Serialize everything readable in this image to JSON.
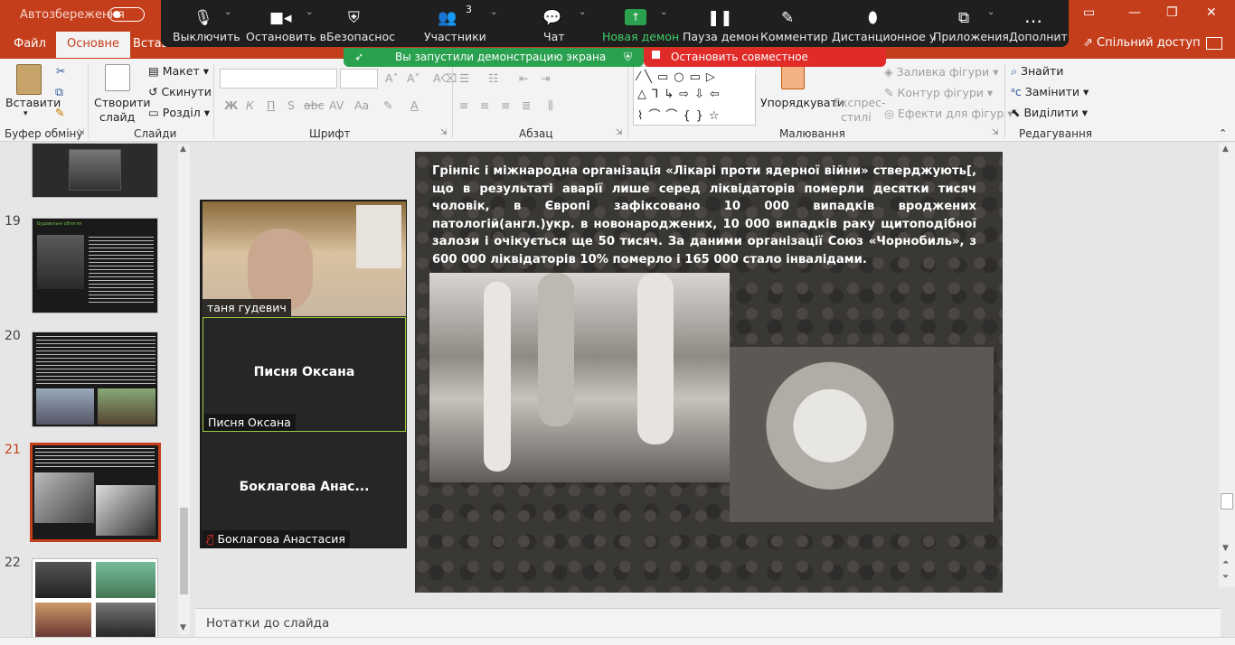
{
  "title_bar": {
    "autosave_label": "Автозбереження",
    "autosave_state": "off"
  },
  "ribbon_tabs": {
    "file": "Файл",
    "home": "Основне",
    "insert": "Вставлення"
  },
  "share_button": "Спільний доступ",
  "zoom_toolbar": {
    "mute": "Выключить",
    "stop_video": "Остановить в",
    "security": "Безопаснос",
    "participants": "Участники",
    "participants_count": "3",
    "chat": "Чат",
    "new_share": "Новая демон",
    "pause_share": "Пауза демон",
    "annotate": "Комментир",
    "remote_control": "Дистанционное у",
    "apps": "Приложения",
    "more": "Дополнит"
  },
  "share_notice": "Вы запустили демонстрацию экрана",
  "stop_share": "Остановить совместное использование",
  "ribbon": {
    "clipboard": {
      "paste": "Вставити",
      "label": "Буфер обміну"
    },
    "slides": {
      "new_slide_1": "Створити",
      "new_slide_2": "слайд",
      "layout": "Макет",
      "reset": "Скинути",
      "section": "Розділ",
      "label": "Слайди"
    },
    "font": {
      "bold": "Ж",
      "italic": "К",
      "underline": "П",
      "strike": "abc",
      "spacing": "AV",
      "case": "Aa",
      "label": "Шрифт"
    },
    "paragraph": {
      "label": "Абзац"
    },
    "drawing": {
      "arrange": "Упорядкувати",
      "quick_styles_1": "Експрес-",
      "quick_styles_2": "стилі",
      "fill": "Заливка фігури",
      "outline": "Контур фігури",
      "effects": "Ефекти для фігур",
      "label": "Малювання"
    },
    "editing": {
      "find": "Знайти",
      "replace": "Замінити",
      "select": "Виділити",
      "label": "Редагування"
    }
  },
  "thumbnails": {
    "n19": "19",
    "n20": "20",
    "n21": "21",
    "n22": "22",
    "thumb19_title": "Будівельні об'єкти"
  },
  "slide": {
    "text": "Грінпіс і міжнародна організація «Лікарі проти ядерної війни» стверджують[, що в результаті аварії лише серед ліквідаторів померли десятки тисяч чоловік, в Європі зафіксовано 10 000 випадків вроджених патологій(англ.)укр. в новонароджених, 10 000 випадків раку щитоподібної залози і очікується ще 50 тисяч. За даними організації Союз «Чорнобиль», з 600 000 ліквідаторів 10% померло і 165 000 стало інвалідами."
  },
  "video_gallery": {
    "p1_name": "таня гудевич",
    "p2_center": "Писня Оксана",
    "p2_name": "Писня Оксана",
    "p3_center": "Боклагова  Анас...",
    "p3_name": "Боклагова Анастасия"
  },
  "notes_placeholder": "Нотатки до слайда",
  "colors": {
    "accent": "#c43e1c",
    "zoom_green": "#2aa14f",
    "zoom_red": "#e02b28"
  }
}
